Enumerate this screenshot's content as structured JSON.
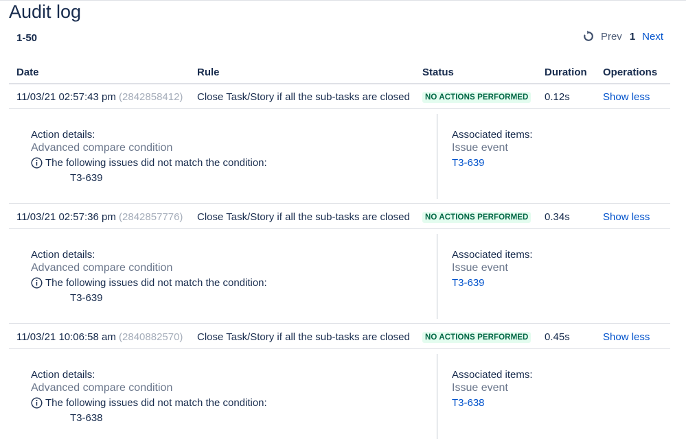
{
  "page": {
    "title": "Audit log",
    "range": "1-50"
  },
  "pagination": {
    "prev_label": "Prev",
    "current_page": "1",
    "next_label": "Next"
  },
  "columns": {
    "date": "Date",
    "rule": "Rule",
    "status": "Status",
    "duration": "Duration",
    "operations": "Operations"
  },
  "rows": [
    {
      "date": "11/03/21 02:57:43 pm",
      "execution_id": "(2842858412)",
      "rule": "Close Task/Story if all the sub-tasks are closed",
      "status": "NO ACTIONS PERFORMED",
      "duration": "0.12s",
      "operation": "Show less",
      "details": {
        "action_label": "Action details:",
        "action_name": "Advanced compare condition",
        "message": "The following issues did not match the condition:",
        "issue": "T3-639",
        "assoc_label": "Associated items:",
        "assoc_type": "Issue event",
        "assoc_link": "T3-639"
      }
    },
    {
      "date": "11/03/21 02:57:36 pm",
      "execution_id": "(2842857776)",
      "rule": "Close Task/Story if all the sub-tasks are closed",
      "status": "NO ACTIONS PERFORMED",
      "duration": "0.34s",
      "operation": "Show less",
      "details": {
        "action_label": "Action details:",
        "action_name": "Advanced compare condition",
        "message": "The following issues did not match the condition:",
        "issue": "T3-639",
        "assoc_label": "Associated items:",
        "assoc_type": "Issue event",
        "assoc_link": "T3-639"
      }
    },
    {
      "date": "11/03/21 10:06:58 am",
      "execution_id": "(2840882570)",
      "rule": "Close Task/Story if all the sub-tasks are closed",
      "status": "NO ACTIONS PERFORMED",
      "duration": "0.45s",
      "operation": "Show less",
      "details": {
        "action_label": "Action details:",
        "action_name": "Advanced compare condition",
        "message": "The following issues did not match the condition:",
        "issue": "T3-638",
        "assoc_label": "Associated items:",
        "assoc_type": "Issue event",
        "assoc_link": "T3-638"
      }
    }
  ],
  "colors": {
    "link": "#0052cc",
    "badge_text": "#006644",
    "badge_bg": "#e3fcef",
    "muted": "#6b778c"
  },
  "icons": {
    "refresh": "refresh-icon",
    "info": "info-icon"
  }
}
